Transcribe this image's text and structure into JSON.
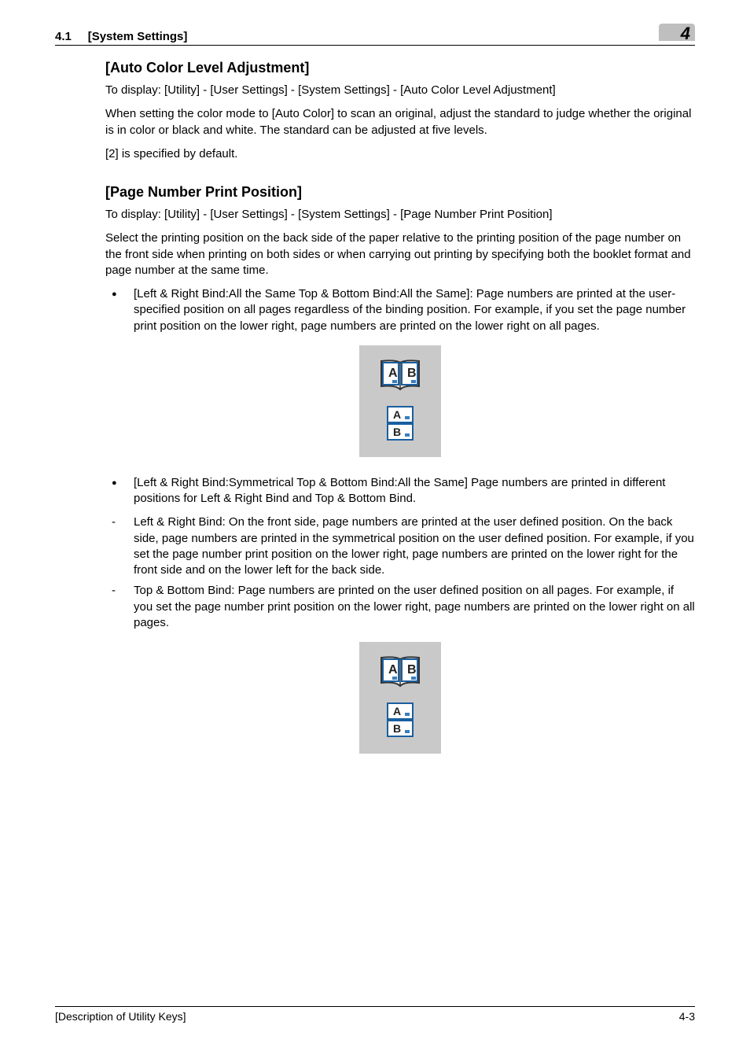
{
  "header": {
    "section_no": "4.1",
    "section_title": "[System Settings]",
    "chapter_no": "4"
  },
  "section1": {
    "title": "[Auto Color Level Adjustment]",
    "para1": "To display: [Utility] - [User Settings] - [System Settings] - [Auto Color Level Adjustment]",
    "para2": "When setting the color mode to [Auto Color] to scan an original, adjust the standard to judge whether the original is in color or black and white. The standard can be adjusted at five levels.",
    "para3": "[2] is specified by default."
  },
  "section2": {
    "title": "[Page Number Print Position]",
    "para1": "To display: [Utility] - [User Settings] - [System Settings] - [Page Number Print Position]",
    "para2": "Select the printing position on the back side of the paper relative to the printing position of the page number on the front side when printing on both sides or when carrying out printing by specifying both the booklet format and page number at the same time.",
    "bullet1": "[Left & Right Bind:All the Same Top & Bottom Bind:All the Same]: Page numbers are printed at the user-specified position on all pages regardless of the binding position. For example, if you set the page number print position on the lower right, page numbers are printed on the lower right on all pages.",
    "bullet2": "[Left & Right Bind:Symmetrical Top & Bottom Bind:All the Same] Page numbers are printed in different positions for Left & Right Bind and Top & Bottom Bind.",
    "dash1": "Left & Right Bind: On the front side, page numbers are printed at the user defined position. On the back side, page numbers are printed in the symmetrical position on the user defined position. For example, if you set the page number print position on the lower right, page numbers are printed on the lower right for the front side and on the lower left for the back side.",
    "dash2": "Top & Bottom Bind: Page numbers are printed on the user defined position on all pages. For example, if you set the page number print position on the lower right, page numbers are printed on the lower right on all pages."
  },
  "figure": {
    "labelA": "A",
    "labelB": "B"
  },
  "footer": {
    "left": "[Description of Utility Keys]",
    "right": "4-3"
  }
}
